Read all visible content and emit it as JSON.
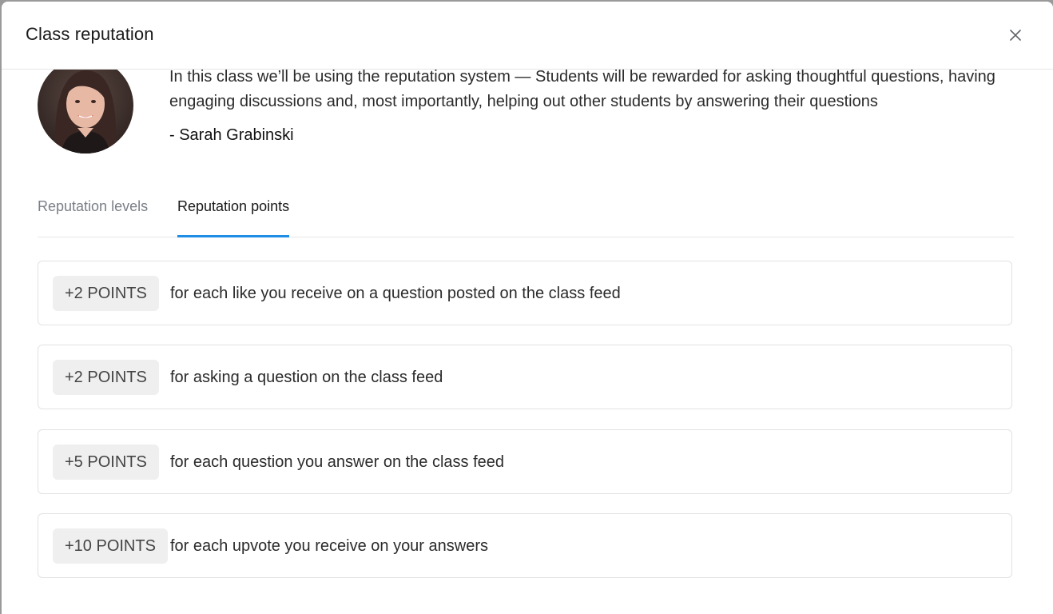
{
  "dialog": {
    "title": "Class reputation"
  },
  "intro": {
    "quote": "In this class we’ll be using the reputation system — Students will be rewarded for asking thoughtful questions, having engaging discussions and, most importantly, helping out other students by answering their questions",
    "author": "- Sarah Grabinski"
  },
  "tabs": [
    {
      "label": "Reputation levels",
      "active": false
    },
    {
      "label": "Reputation points",
      "active": true
    }
  ],
  "points": [
    {
      "badge": "+2 POINTS",
      "text": "for each like you receive on a question posted on the class feed"
    },
    {
      "badge": "+2 POINTS",
      "text": "for asking a question on the class feed"
    },
    {
      "badge": "+5 POINTS",
      "text": "for each question you answer on the class feed"
    },
    {
      "badge": "+10 POINTS",
      "text": "for each upvote you receive on your answers"
    }
  ],
  "colors": {
    "accent": "#1f8ce6",
    "badge_bg": "#efefef"
  }
}
